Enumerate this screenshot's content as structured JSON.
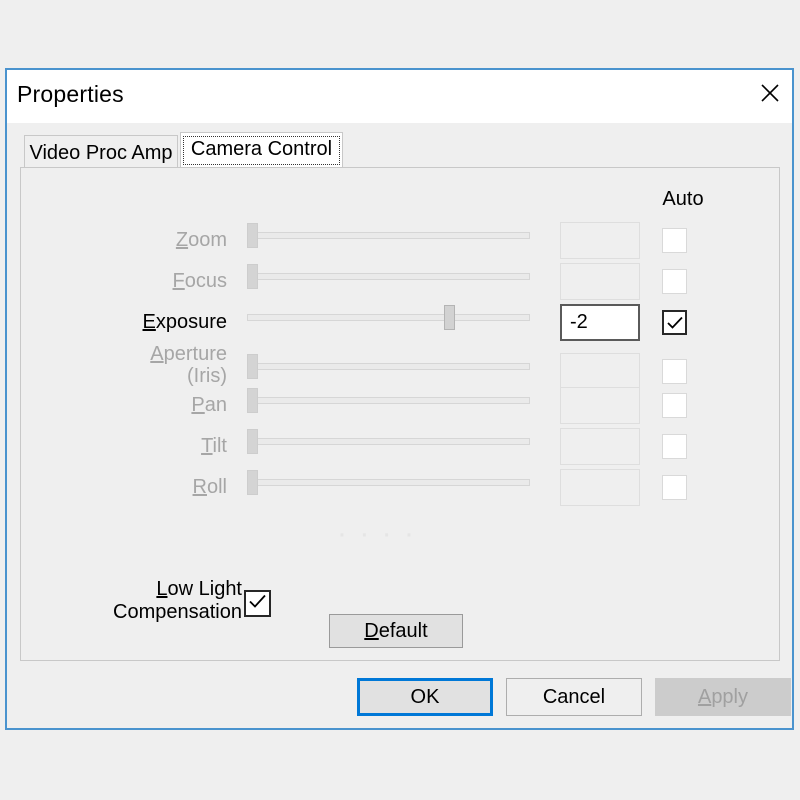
{
  "window": {
    "title": "Properties",
    "close_icon": "close-icon"
  },
  "tabs": [
    {
      "label": "Video Proc Amp",
      "active": false
    },
    {
      "label": "Camera Control",
      "active": true
    }
  ],
  "panel": {
    "auto_column_header": "Auto",
    "rows": [
      {
        "label": "Zoom",
        "accel": "Z",
        "label_rest": "oom",
        "enabled": false,
        "slider_percent": 0,
        "value": "",
        "auto_checked": false,
        "auto_enabled": false
      },
      {
        "label": "Focus",
        "accel": "F",
        "label_rest": "ocus",
        "enabled": false,
        "slider_percent": 0,
        "value": "",
        "auto_checked": false,
        "auto_enabled": false
      },
      {
        "label": "Exposure",
        "accel": "E",
        "label_rest": "xposure",
        "enabled": true,
        "slider_percent": 71,
        "value": "-2",
        "auto_checked": true,
        "auto_enabled": true
      },
      {
        "label": "Aperture (Iris)",
        "accel": "A",
        "label_rest": "perture\n(Iris)",
        "enabled": false,
        "slider_percent": 0,
        "value": "",
        "auto_checked": false,
        "auto_enabled": false
      },
      {
        "label": "Pan",
        "accel": "P",
        "label_rest": "an",
        "enabled": false,
        "slider_percent": 0,
        "value": "",
        "auto_checked": false,
        "auto_enabled": false
      },
      {
        "label": "Tilt",
        "accel": "T",
        "label_rest": "ilt",
        "enabled": false,
        "slider_percent": 0,
        "value": "",
        "auto_checked": false,
        "auto_enabled": false
      },
      {
        "label": "Roll",
        "accel": "R",
        "label_rest": "oll",
        "enabled": false,
        "slider_percent": 0,
        "value": "",
        "auto_checked": false,
        "auto_enabled": false
      }
    ],
    "low_light": {
      "accel": "L",
      "label_rest": "ow Light\nCompensation",
      "checked": true
    },
    "default_button": {
      "accel": "D",
      "label_rest": "efault"
    }
  },
  "footer": {
    "ok": "OK",
    "cancel": "Cancel",
    "apply_accel": "A",
    "apply_rest": "pply",
    "apply_enabled": false
  },
  "colors": {
    "dialog_border": "#4a93ce",
    "focus_accent": "#0078d7",
    "disabled_text": "#a6a6a6",
    "background": "#efefef"
  }
}
